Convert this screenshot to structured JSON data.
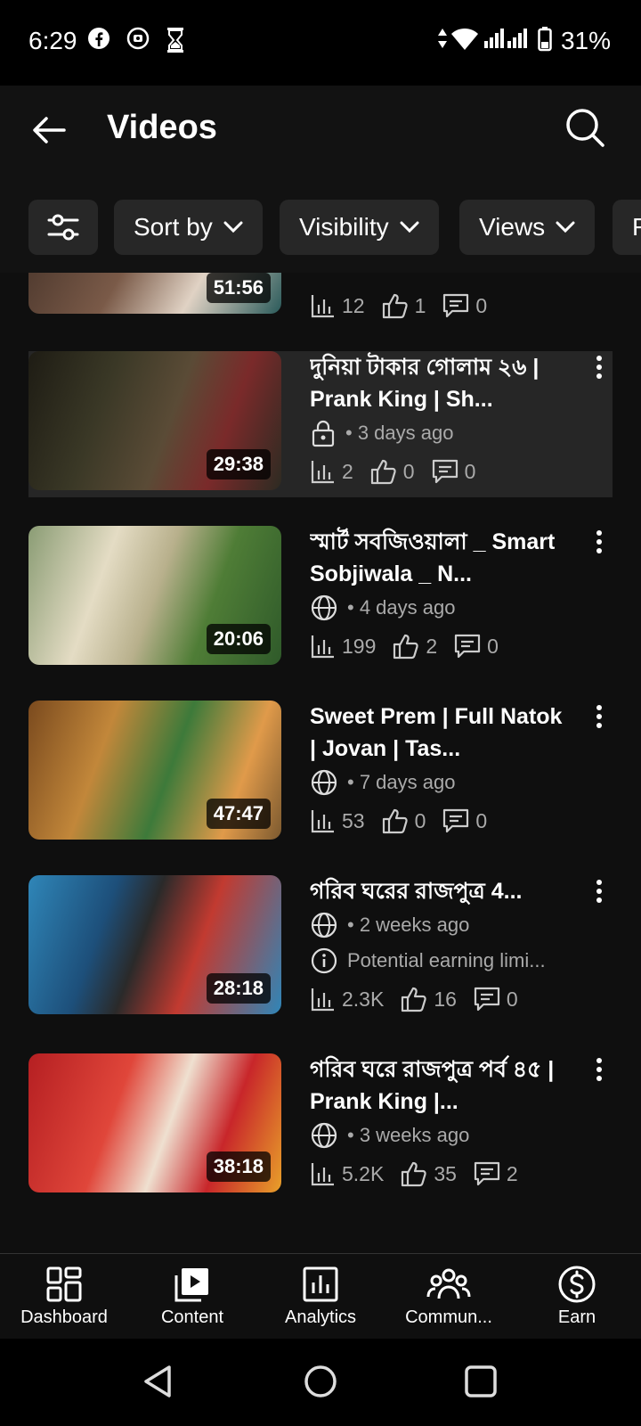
{
  "status_bar": {
    "time": "6:29",
    "battery_pct": "31%",
    "icons": [
      "facebook-icon",
      "notification-icon",
      "hourglass-icon",
      "data-icon",
      "wifi-icon",
      "signal-icon",
      "battery-icon"
    ]
  },
  "header": {
    "title": "Videos"
  },
  "chips": [
    {
      "label": ""
    },
    {
      "label": "Sort by"
    },
    {
      "label": "Visibility"
    },
    {
      "label": "Views"
    },
    {
      "label": "F"
    }
  ],
  "videos": [
    {
      "title": "",
      "duration": "51:56",
      "visibility": "",
      "age": "",
      "views": "12",
      "likes": "1",
      "comments": "0",
      "thumb_colors": [
        "#5a3b30",
        "#8a6b5a",
        "#d8c6b6"
      ]
    },
    {
      "title": "দুনিয়া টাকার গোলাম ২৬ | Prank King | Sh...",
      "duration": "29:38",
      "visibility": "private",
      "age": "• 3 days ago",
      "views": "2",
      "likes": "0",
      "comments": "0",
      "thumb_colors": [
        "#2b2a1e",
        "#4d4a35",
        "#8b2f2f"
      ]
    },
    {
      "title": "স্মার্ট সবজিওয়ালা _ Smart Sobjiwala _ N...",
      "duration": "20:06",
      "visibility": "public",
      "age": "• 4 days ago",
      "views": "199",
      "likes": "2",
      "comments": "0",
      "thumb_colors": [
        "#6e8a52",
        "#c6c0a2",
        "#2f6a2a"
      ]
    },
    {
      "title": "Sweet Prem | Full Natok | Jovan | Tas...",
      "duration": "47:47",
      "visibility": "public",
      "age": "• 7 days ago",
      "views": "53",
      "likes": "0",
      "comments": "0",
      "thumb_colors": [
        "#a46a2a",
        "#3c7a3a",
        "#d98a3a"
      ]
    },
    {
      "title": "গরিব ঘরের রাজপুত্র 4...",
      "duration": "28:18",
      "visibility": "public",
      "age": "• 2 weeks ago",
      "note": "Potential earning limi...",
      "views": "2.3K",
      "likes": "16",
      "comments": "0",
      "thumb_colors": [
        "#2b78a8",
        "#1d4f7a",
        "#b9372f"
      ]
    },
    {
      "title": "গরিব ঘরে রাজপুত্র পর্ব ৪৫ | Prank King |...",
      "duration": "38:18",
      "visibility": "public",
      "age": "• 3 weeks ago",
      "views": "5.2K",
      "likes": "35",
      "comments": "2",
      "thumb_colors": [
        "#c8262a",
        "#e0463a",
        "#f2d2b0"
      ]
    }
  ],
  "bottom_nav": [
    {
      "label": "Dashboard",
      "icon": "dashboard-icon"
    },
    {
      "label": "Content",
      "icon": "content-icon"
    },
    {
      "label": "Analytics",
      "icon": "analytics-icon"
    },
    {
      "label": "Commun...",
      "icon": "community-icon"
    },
    {
      "label": "Earn",
      "icon": "earn-icon"
    }
  ]
}
